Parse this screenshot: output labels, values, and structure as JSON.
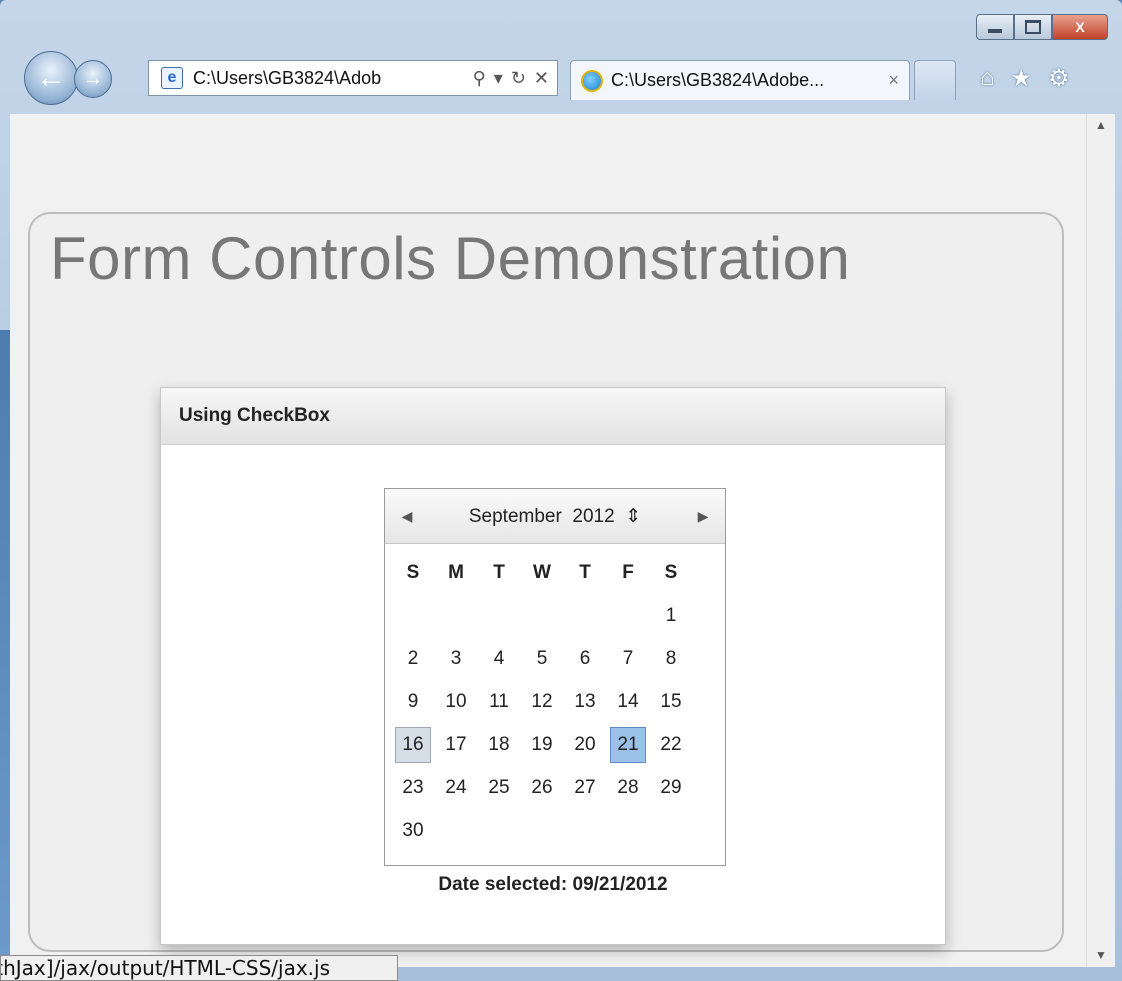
{
  "window": {
    "caption_buttons": [
      "minimize",
      "maximize",
      "close"
    ],
    "close_glyph": "X"
  },
  "browser": {
    "address": "C:\\Users\\GB3824\\Adob",
    "tab_title": "C:\\Users\\GB3824\\Adobe...",
    "tab_close": "×",
    "toolbar_icons": [
      "home-icon",
      "favorites-star-icon",
      "tools-gear-icon"
    ]
  },
  "page": {
    "title": "Form Controls Demonstration",
    "card_title": "Using CheckBox",
    "calendar": {
      "month": "September",
      "year": "2012",
      "weekdays": [
        "S",
        "M",
        "T",
        "W",
        "T",
        "F",
        "S"
      ],
      "weeks": [
        [
          "",
          "",
          "",
          "",
          "",
          "",
          "1"
        ],
        [
          "2",
          "3",
          "4",
          "5",
          "6",
          "7",
          "8"
        ],
        [
          "9",
          "10",
          "11",
          "12",
          "13",
          "14",
          "15"
        ],
        [
          "16",
          "17",
          "18",
          "19",
          "20",
          "21",
          "22"
        ],
        [
          "23",
          "24",
          "25",
          "26",
          "27",
          "28",
          "29"
        ],
        [
          "30",
          "",
          "",
          "",
          "",
          "",
          ""
        ]
      ],
      "today": "16",
      "selected": "21"
    },
    "date_selected": "Date selected: 09/21/2012"
  },
  "status_bar": "athJax]/jax/output/HTML-CSS/jax.js"
}
